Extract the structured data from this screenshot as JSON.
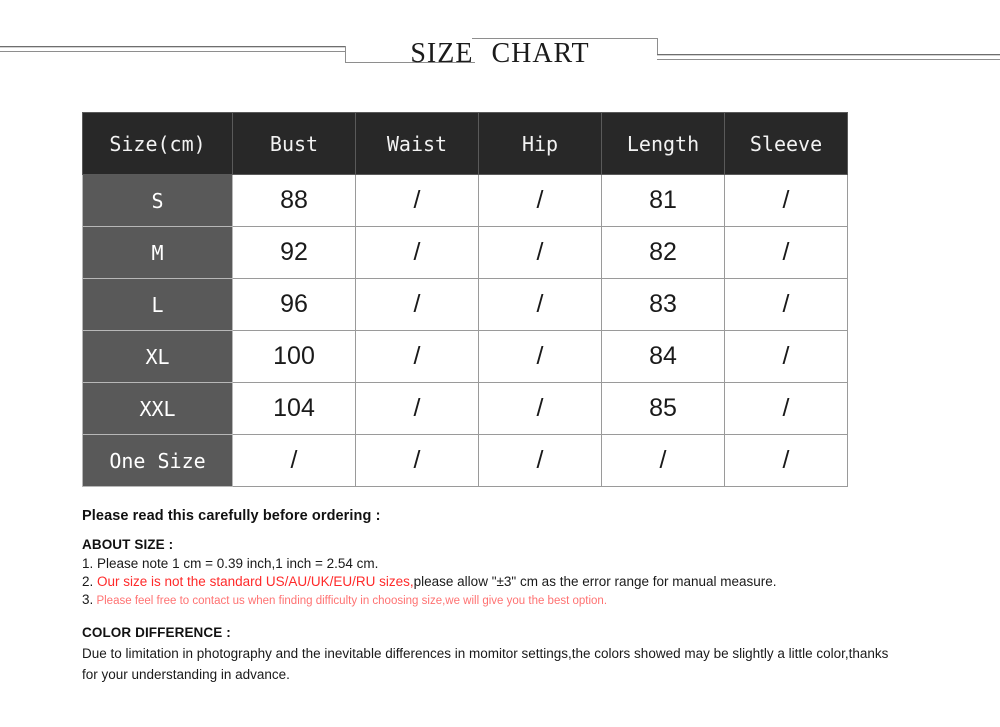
{
  "banner": {
    "title_word1": "SIZE",
    "title_word2": "CHART"
  },
  "table": {
    "headers": [
      "Size(cm)",
      "Bust",
      "Waist",
      "Hip",
      "Length",
      "Sleeve"
    ],
    "rows": [
      {
        "size": "S",
        "bust": "88",
        "waist": "/",
        "hip": "/",
        "length": "81",
        "sleeve": "/"
      },
      {
        "size": "M",
        "bust": "92",
        "waist": "/",
        "hip": "/",
        "length": "82",
        "sleeve": "/"
      },
      {
        "size": "L",
        "bust": "96",
        "waist": "/",
        "hip": "/",
        "length": "83",
        "sleeve": "/"
      },
      {
        "size": "XL",
        "bust": "100",
        "waist": "/",
        "hip": "/",
        "length": "84",
        "sleeve": "/"
      },
      {
        "size": "XXL",
        "bust": "104",
        "waist": "/",
        "hip": "/",
        "length": "85",
        "sleeve": "/"
      },
      {
        "size": "One Size",
        "bust": "/",
        "waist": "/",
        "hip": "/",
        "length": "/",
        "sleeve": "/"
      }
    ],
    "header_bg": "#282828",
    "size_col_bg": "#595959"
  },
  "notes": {
    "heading": "Please read this carefully before ordering :",
    "about_size_heading": "ABOUT SIZE :",
    "item1": "1. Please note 1 cm = 0.39 inch,1 inch = 2.54 cm.",
    "item2_num": "2.",
    "item2_red": " Our size is not the standard US/AU/UK/EU/RU sizes,",
    "item2_black": "please allow \"±3\" cm as the error range for manual measure.",
    "item3_num": "3.",
    "item3_red": " Please feel free to contact us when finding difficulty in choosing size,we will give you the best option.",
    "color_diff_heading": "COLOR DIFFERENCE :",
    "color_diff_body": "Due to limitation in photography and the inevitable differences in momitor settings,the colors showed may be slightly a little color,thanks for your understanding in advance.",
    "red_color": "#ff2a2a",
    "red_light_color": "#ff7272"
  }
}
